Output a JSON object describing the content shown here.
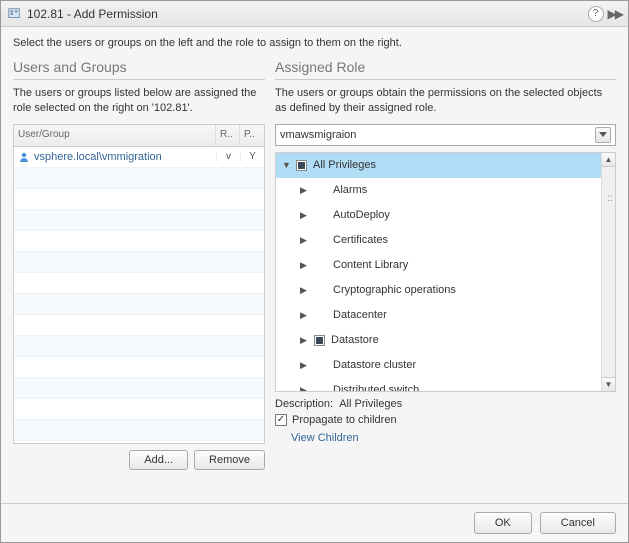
{
  "title": "102.81 - Add Permission",
  "instruction": "Select the users or groups on the left and the role to assign to them on the right.",
  "left": {
    "heading": "Users and Groups",
    "desc": "The users or groups listed below are assigned the role selected on the right on '102.81'.",
    "cols": {
      "user": "User/Group",
      "r": "R..",
      "p": "P.."
    },
    "rows": [
      {
        "name": "vsphere.local\\vmmigration",
        "r": "v",
        "p": "Y"
      }
    ],
    "add": "Add...",
    "remove": "Remove"
  },
  "right": {
    "heading": "Assigned Role",
    "desc": "The users or groups obtain the permissions on the selected objects as defined by their assigned role.",
    "selected_role": "vmawsmigraion",
    "tree": {
      "root": "All Privileges",
      "children": [
        {
          "label": "Alarms",
          "checked": false
        },
        {
          "label": "AutoDeploy",
          "checked": false
        },
        {
          "label": "Certificates",
          "checked": false
        },
        {
          "label": "Content Library",
          "checked": false
        },
        {
          "label": "Cryptographic operations",
          "checked": false
        },
        {
          "label": "Datacenter",
          "checked": false
        },
        {
          "label": "Datastore",
          "checked": true
        },
        {
          "label": "Datastore cluster",
          "checked": false
        },
        {
          "label": "Distributed switch",
          "checked": false
        }
      ]
    },
    "description_label": "Description:",
    "description_value": "All Privileges",
    "propagate": "Propagate to children",
    "view_children": "View Children"
  },
  "footer": {
    "ok": "OK",
    "cancel": "Cancel"
  }
}
